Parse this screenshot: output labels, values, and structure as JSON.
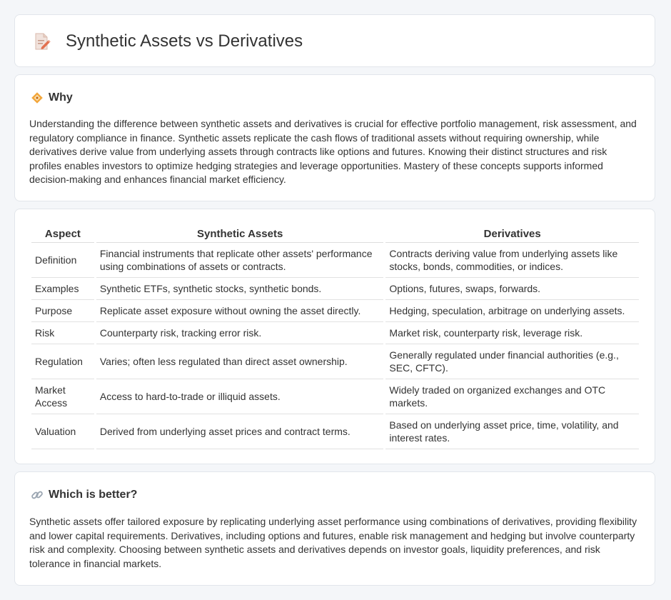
{
  "header": {
    "title": "Synthetic Assets vs Derivatives",
    "icon": "document-pencil-icon"
  },
  "why": {
    "title": "Why",
    "icon": "diamond-badge-icon",
    "text": "Understanding the difference between synthetic assets and derivatives is crucial for effective portfolio management, risk assessment, and regulatory compliance in finance. Synthetic assets replicate the cash flows of traditional assets without requiring ownership, while derivatives derive value from underlying assets through contracts like options and futures. Knowing their distinct structures and risk profiles enables investors to optimize hedging strategies and leverage opportunities. Mastery of these concepts supports informed decision-making and enhances financial market efficiency."
  },
  "table": {
    "headers": [
      "Aspect",
      "Synthetic Assets",
      "Derivatives"
    ],
    "rows": [
      {
        "aspect": "Definition",
        "synthetic": "Financial instruments that replicate other assets' performance using combinations of assets or contracts.",
        "derivatives": "Contracts deriving value from underlying assets like stocks, bonds, commodities, or indices."
      },
      {
        "aspect": "Examples",
        "synthetic": "Synthetic ETFs, synthetic stocks, synthetic bonds.",
        "derivatives": "Options, futures, swaps, forwards."
      },
      {
        "aspect": "Purpose",
        "synthetic": "Replicate asset exposure without owning the asset directly.",
        "derivatives": "Hedging, speculation, arbitrage on underlying assets."
      },
      {
        "aspect": "Risk",
        "synthetic": "Counterparty risk, tracking error risk.",
        "derivatives": "Market risk, counterparty risk, leverage risk."
      },
      {
        "aspect": "Regulation",
        "synthetic": "Varies; often less regulated than direct asset ownership.",
        "derivatives": "Generally regulated under financial authorities (e.g., SEC, CFTC)."
      },
      {
        "aspect": "Market Access",
        "synthetic": "Access to hard-to-trade or illiquid assets.",
        "derivatives": "Widely traded on organized exchanges and OTC markets."
      },
      {
        "aspect": "Valuation",
        "synthetic": "Derived from underlying asset prices and contract terms.",
        "derivatives": "Based on underlying asset price, time, volatility, and interest rates."
      }
    ]
  },
  "better": {
    "title": "Which is better?",
    "icon": "link-icon",
    "text": "Synthetic assets offer tailored exposure by replicating underlying asset performance using combinations of derivatives, providing flexibility and lower capital requirements. Derivatives, including options and futures, enable risk management and hedging but involve counterparty risk and complexity. Choosing between synthetic assets and derivatives depends on investor goals, liquidity preferences, and risk tolerance in financial markets."
  }
}
